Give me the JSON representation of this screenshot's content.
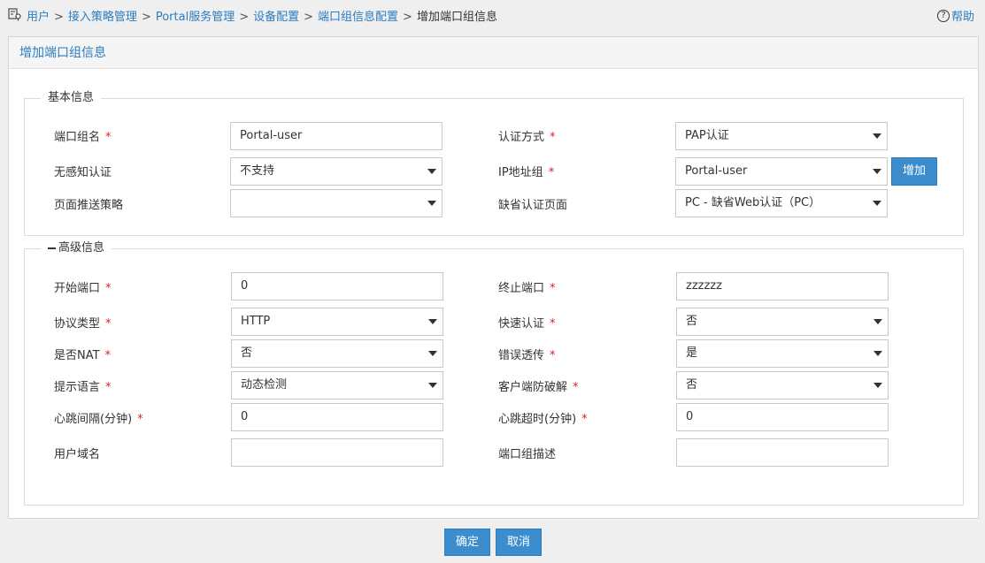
{
  "breadcrumb": {
    "items": [
      "用户",
      "接入策略管理",
      "Portal服务管理",
      "设备配置",
      "端口组信息配置"
    ],
    "current": "增加端口组信息",
    "separator": ">"
  },
  "help": {
    "label": "帮助"
  },
  "panel": {
    "title": "增加端口组信息"
  },
  "basic": {
    "legend": "基本信息",
    "port_group_name": {
      "label": "端口组名",
      "value": "Portal-user"
    },
    "auth_method": {
      "label": "认证方式",
      "value": "PAP认证"
    },
    "seamless_auth": {
      "label": "无感知认证",
      "value": "不支持"
    },
    "ip_group": {
      "label": "IP地址组",
      "value": "Portal-user",
      "add_label": "增加"
    },
    "push_policy": {
      "label": "页面推送策略",
      "value": ""
    },
    "default_page": {
      "label": "缺省认证页面",
      "value": "PC - 缺省Web认证（PC）"
    }
  },
  "advanced": {
    "legend": "高级信息",
    "start_port": {
      "label": "开始端口",
      "value": "0"
    },
    "end_port": {
      "label": "终止端口",
      "value": "zzzzzz"
    },
    "protocol": {
      "label": "协议类型",
      "value": "HTTP"
    },
    "fast_auth": {
      "label": "快速认证",
      "value": "否"
    },
    "nat": {
      "label": "是否NAT",
      "value": "否"
    },
    "error_passthrough": {
      "label": "错误透传",
      "value": "是"
    },
    "language": {
      "label": "提示语言",
      "value": "动态检测"
    },
    "anti_crack": {
      "label": "客户端防破解",
      "value": "否"
    },
    "heartbeat_interval": {
      "label": "心跳间隔(分钟)",
      "value": "0"
    },
    "heartbeat_timeout": {
      "label": "心跳超时(分钟)",
      "value": "0"
    },
    "user_domain": {
      "label": "用户域名",
      "value": ""
    },
    "group_desc": {
      "label": "端口组描述",
      "value": ""
    }
  },
  "actions": {
    "confirm": "确定",
    "cancel": "取消"
  },
  "required_mark": "*",
  "colors": {
    "accent": "#3c8dce",
    "link": "#2b7cc1",
    "required": "#e02020"
  }
}
